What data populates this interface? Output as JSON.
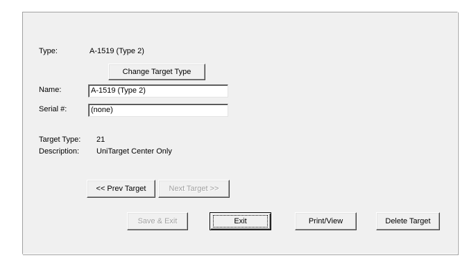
{
  "form": {
    "type_label": "Type:",
    "type_value": "A-1519 (Type 2)",
    "change_type_button": "Change Target Type",
    "name_label": "Name:",
    "name_value": "A-1519 (Type 2)",
    "serial_label": "Serial #:",
    "serial_value": "(none)",
    "target_type_label": "Target Type:",
    "target_type_value": "21",
    "description_label": "Description:",
    "description_value": "UniTarget Center Only"
  },
  "nav": {
    "prev_label": "<< Prev Target",
    "next_label": "Next Target >>",
    "next_disabled": true
  },
  "actions": {
    "save_exit_label": "Save & Exit",
    "save_exit_disabled": true,
    "exit_label": "Exit",
    "print_view_label": "Print/View",
    "delete_target_label": "Delete Target"
  }
}
